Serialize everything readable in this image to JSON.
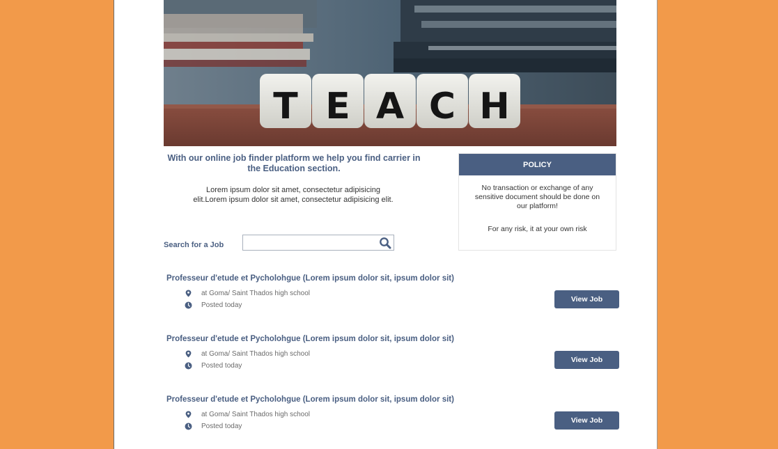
{
  "hero": {
    "letters": [
      "T",
      "E",
      "A",
      "C",
      "H"
    ]
  },
  "tagline": "With our online job finder platform we help you find carrier in the Education section.",
  "intro": "Lorem ipsum dolor sit amet, consectetur adipisicing elit.Lorem ipsum dolor sit amet, consectetur adipisicing elit.",
  "search": {
    "label": "Search for a Job",
    "value": "",
    "placeholder": ""
  },
  "policy": {
    "title": "POLICY",
    "text": "No transaction or exchange of any sensitive document should be done on our platform!",
    "risk": "For any risk, it at your own risk"
  },
  "jobs": [
    {
      "title": "Professeur d'etude et Pycholohgue (Lorem ipsum dolor sit, ipsum dolor sit)",
      "location": "at Goma/ Saint Thados high school",
      "posted": "Posted today",
      "button": "View Job"
    },
    {
      "title": "Professeur d'etude et Pycholohgue (Lorem ipsum dolor sit, ipsum dolor sit)",
      "location": "at Goma/ Saint Thados high school",
      "posted": "Posted today",
      "button": "View Job"
    },
    {
      "title": "Professeur d'etude et Pycholohgue (Lorem ipsum dolor sit, ipsum dolor sit)",
      "location": "at Goma/ Saint Thados high school",
      "posted": "Posted today",
      "button": "View Job"
    }
  ],
  "icons": {
    "location": "location-pin-icon",
    "time": "clock-icon",
    "search": "magnifier-icon"
  },
  "colors": {
    "background": "#f29a4a",
    "accent": "#4a5f82",
    "page": "#ffffff"
  }
}
